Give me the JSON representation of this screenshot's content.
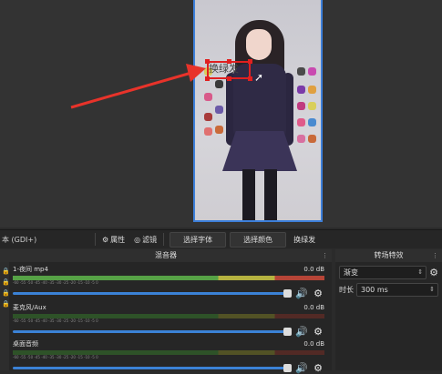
{
  "preview": {
    "selected_text": "换绿发",
    "colors": {
      "selection": "#e02020",
      "canvas_border": "#3d7fd9",
      "arrow": "#e8332a"
    }
  },
  "toolbar": {
    "source_label": "本 (GDI+)",
    "properties_label": "属性",
    "filters_label": "滤镜",
    "select_font_label": "选择字体",
    "select_color_label": "选择颜色",
    "text_value": "换绿发"
  },
  "mixer": {
    "title": "混音器",
    "channels": [
      {
        "name": "1-夜间 mp4",
        "db": "0.0 dB",
        "active": true
      },
      {
        "name": "麦克风/Aux",
        "db": "0.0 dB",
        "active": false
      },
      {
        "name": "桌面音频",
        "db": "0.0 dB",
        "active": false
      }
    ],
    "ticks": "-60 -55 -50 -45 -40 -35 -30 -25 -20 -15 -10 -5 0"
  },
  "transitions": {
    "title": "转场特效",
    "selected": "渐变",
    "duration_label": "时长",
    "duration_value": "300 ms"
  }
}
